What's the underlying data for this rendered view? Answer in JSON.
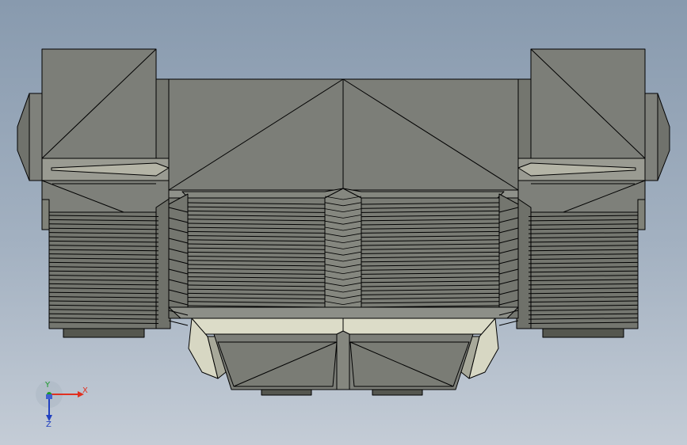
{
  "viewport": {
    "background_top": "#889aae",
    "background_bottom": "#c4ccd6"
  },
  "model": {
    "face_color": "#7b7d77",
    "light_face_color": "#dcdcc8",
    "edge_color": "#000000"
  },
  "triad": {
    "x_label": "X",
    "y_label": "Y",
    "z_label": "Z",
    "x_color": "#e03020",
    "y_color": "#1a9a2a",
    "z_color": "#2040c0"
  }
}
